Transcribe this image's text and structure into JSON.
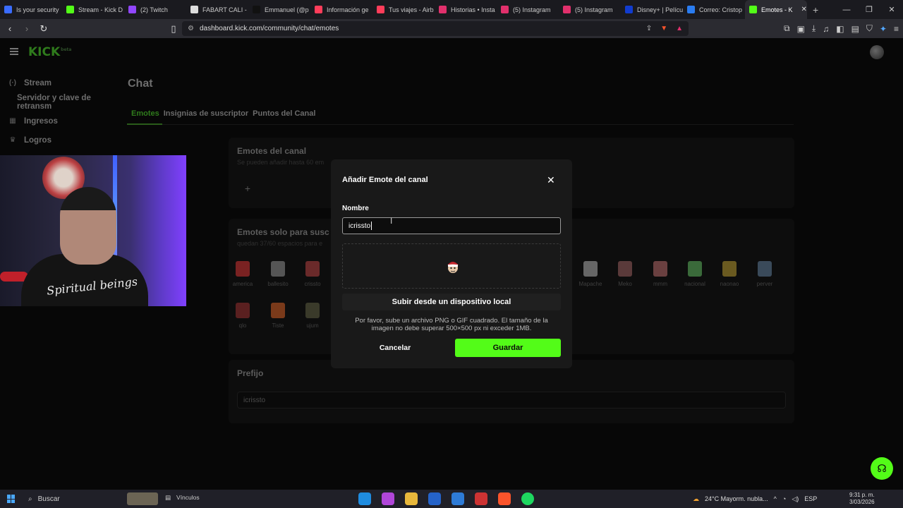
{
  "browser": {
    "tabs": [
      {
        "title": "Is your security",
        "color": "#3a6cff"
      },
      {
        "title": "Stream - Kick D",
        "color": "#53fc18"
      },
      {
        "title": "(2) Twitch",
        "color": "#9146ff"
      },
      {
        "title": "FABART CALI - ",
        "color": "#dddddd"
      },
      {
        "title": "Emmanuel (@p",
        "color": "#111111"
      },
      {
        "title": "Información ge",
        "color": "#ff3d5a"
      },
      {
        "title": "Tus viajes - Airb",
        "color": "#ff3d5a"
      },
      {
        "title": "Historias • Insta",
        "color": "#e1306c"
      },
      {
        "title": "(5) Instagram",
        "color": "#e1306c"
      },
      {
        "title": "(5) Instagram",
        "color": "#e1306c"
      },
      {
        "title": "Disney+ | Pelícu",
        "color": "#113ccf"
      },
      {
        "title": "Correo: Cristop",
        "color": "#2a7cf0"
      },
      {
        "title": "Emotes - K",
        "color": "#53fc18",
        "active": true
      }
    ],
    "url": "dashboard.kick.com/community/chat/emotes"
  },
  "sidebar": {
    "items": [
      {
        "label": "Stream",
        "icon": "broadcast-icon"
      },
      {
        "label": "Servidor y clave de retransm",
        "sub": true
      },
      {
        "label": "Ingresos",
        "icon": "money-icon"
      },
      {
        "label": "Logros",
        "icon": "trophy-icon"
      }
    ]
  },
  "header": {
    "logo": "KICK",
    "logo_badge": "beta"
  },
  "main": {
    "title": "Chat",
    "tabs": [
      {
        "label": "Emotes",
        "active": true
      },
      {
        "label": "Insignias de suscriptor"
      },
      {
        "label": "Puntos del Canal"
      }
    ],
    "channel_emotes": {
      "title": "Emotes del canal",
      "desc": "Se pueden añadir hasta 60 em"
    },
    "sub_emotes": {
      "title": "Emotes solo para susc",
      "desc": "quedan 37/60 espacios para e",
      "emotes": [
        "america",
        "ballesito",
        "crissto",
        "Mapache",
        "Meko",
        "mmm",
        "nacional",
        "naonao",
        "perver",
        "qlo",
        "Tiste",
        "ujum"
      ]
    },
    "prefix": {
      "title": "Prefijo",
      "value": "icrissto"
    }
  },
  "modal": {
    "title": "Añadir Emote del canal",
    "name_label": "Nombre",
    "name_value": "icrissto",
    "upload_label": "Subir desde un dispositivo local",
    "hint": "Por favor, sube un archivo PNG o GIF cuadrado. El tamaño de la imagen no debe superar 500×500 px ni exceder 1MB.",
    "cancel_label": "Cancelar",
    "save_label": "Guardar"
  },
  "webcam": {
    "shirt_text": "Spiritual beings"
  },
  "taskbar": {
    "search_placeholder": "Buscar",
    "links_label": "Vínculos",
    "weather": "24°C  Mayorm. nubla...",
    "lang": "ESP",
    "time": "9:31 p. m.",
    "date": "3/03/2026"
  },
  "colors": {
    "accent": "#53fc18",
    "modal_bg": "#191919"
  }
}
